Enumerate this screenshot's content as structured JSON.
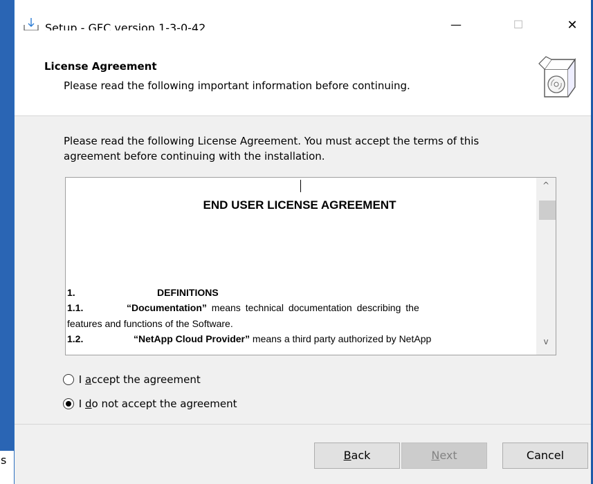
{
  "window": {
    "title": "Setup - GFC version 1-3-0-42",
    "minimize_glyph": "—",
    "maximize_glyph": "☐",
    "close_glyph": "✕"
  },
  "header": {
    "title": "License Agreement",
    "subtitle": "Please read the following important information before continuing."
  },
  "body": {
    "intro_line1": "Please read the following License Agreement. You must accept the terms of this",
    "intro_line2": "agreement before continuing with the installation."
  },
  "license": {
    "heading": "END USER LICENSE AGREEMENT",
    "section_number": "1.",
    "section_title": "DEFINITIONS",
    "line1_num": "1.1.",
    "line1_term": "“Documentation”",
    "line1_text": " means technical documentation describing the",
    "line2_text": "features and functions of the Software.",
    "line3_num": "1.2.",
    "line3_term": "“NetApp Cloud Provider”",
    "line3_text": " means a third party authorized by NetApp",
    "scroll_up_glyph": "^",
    "scroll_down_glyph": "v"
  },
  "options": {
    "accept_pre": "I ",
    "accept_key": "a",
    "accept_post": "ccept the agreement",
    "decline_pre": "I ",
    "decline_key": "d",
    "decline_post": "o not accept the agreement",
    "selected": "decline"
  },
  "buttons": {
    "back_key": "B",
    "back_rest": "ack",
    "next_key": "N",
    "next_rest": "ext",
    "cancel": "Cancel"
  },
  "outside": {
    "fragment": "s"
  },
  "colors": {
    "desktop_blue": "#1e5aa8",
    "dialog_bg": "#f0f0f0",
    "disabled_text": "#838383"
  }
}
